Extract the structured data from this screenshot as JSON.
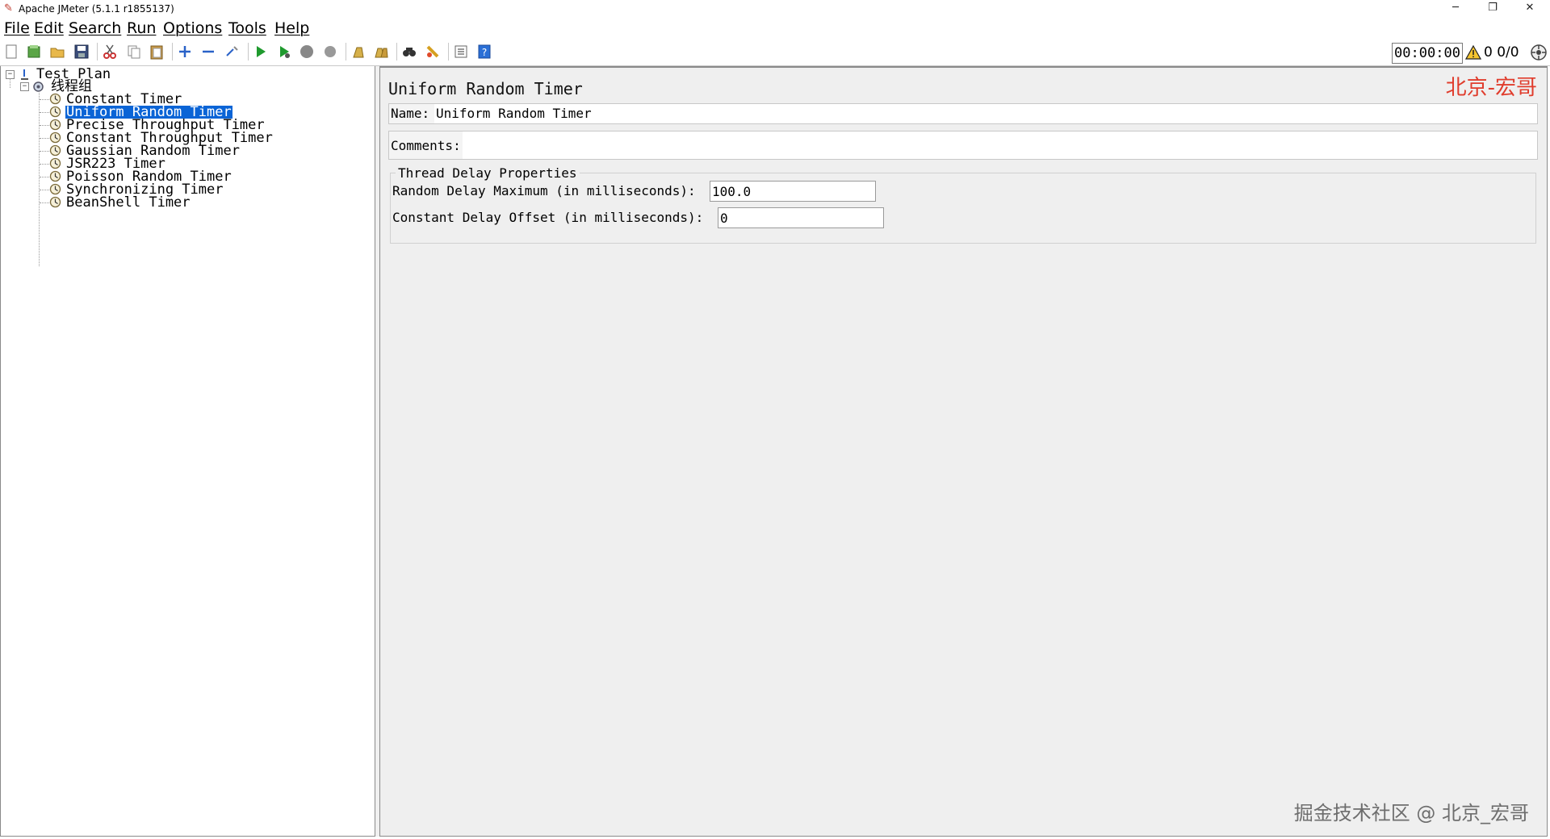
{
  "window": {
    "title": "Apache JMeter (5.1.1 r1855137)",
    "minimize": "─",
    "restore": "❐",
    "close": "✕"
  },
  "menu": {
    "items": [
      "File",
      "Edit",
      "Search",
      "Run",
      "Options",
      "Tools",
      "Help"
    ]
  },
  "toolbar": {
    "icons": [
      "new-icon",
      "templates-icon",
      "open-icon",
      "save-icon",
      "cut-icon",
      "copy-icon",
      "paste-icon",
      "expand-icon",
      "collapse-icon",
      "toggle-icon",
      "start-icon",
      "start-no-pause-icon",
      "stop-icon",
      "shutdown-icon",
      "clear-icon",
      "clear-all-icon",
      "search-icon",
      "reset-search-icon",
      "function-helper-icon",
      "help-icon"
    ]
  },
  "status": {
    "elapsed": "00:00:00",
    "errors": "0",
    "threads": "0/0"
  },
  "tree": {
    "root": "Test Plan",
    "thread_group": "线程组",
    "items": [
      "Constant Timer",
      "Uniform Random Timer",
      "Precise Throughput Timer",
      "Constant Throughput Timer",
      "Gaussian Random Timer",
      "JSR223 Timer",
      "Poisson Random Timer",
      "Synchronizing Timer",
      "BeanShell Timer"
    ],
    "selected_index": 1
  },
  "panel": {
    "title": "Uniform Random Timer",
    "name_label": "Name:",
    "name_value": "Uniform Random Timer",
    "comments_label": "Comments:",
    "comments_value": "",
    "group_title": "Thread Delay Properties",
    "random_delay_label": "Random Delay Maximum (in milliseconds):",
    "random_delay_value": "100.0",
    "constant_offset_label": "Constant Delay Offset (in milliseconds):",
    "constant_offset_value": "0"
  },
  "watermarks": {
    "top_right": "北京-宏哥",
    "bottom_right": "掘金技术社区 @ 北京_宏哥"
  },
  "colors": {
    "selection": "#0a64d6",
    "watermark_red": "#e03c2c",
    "panel_bg": "#efefef"
  }
}
